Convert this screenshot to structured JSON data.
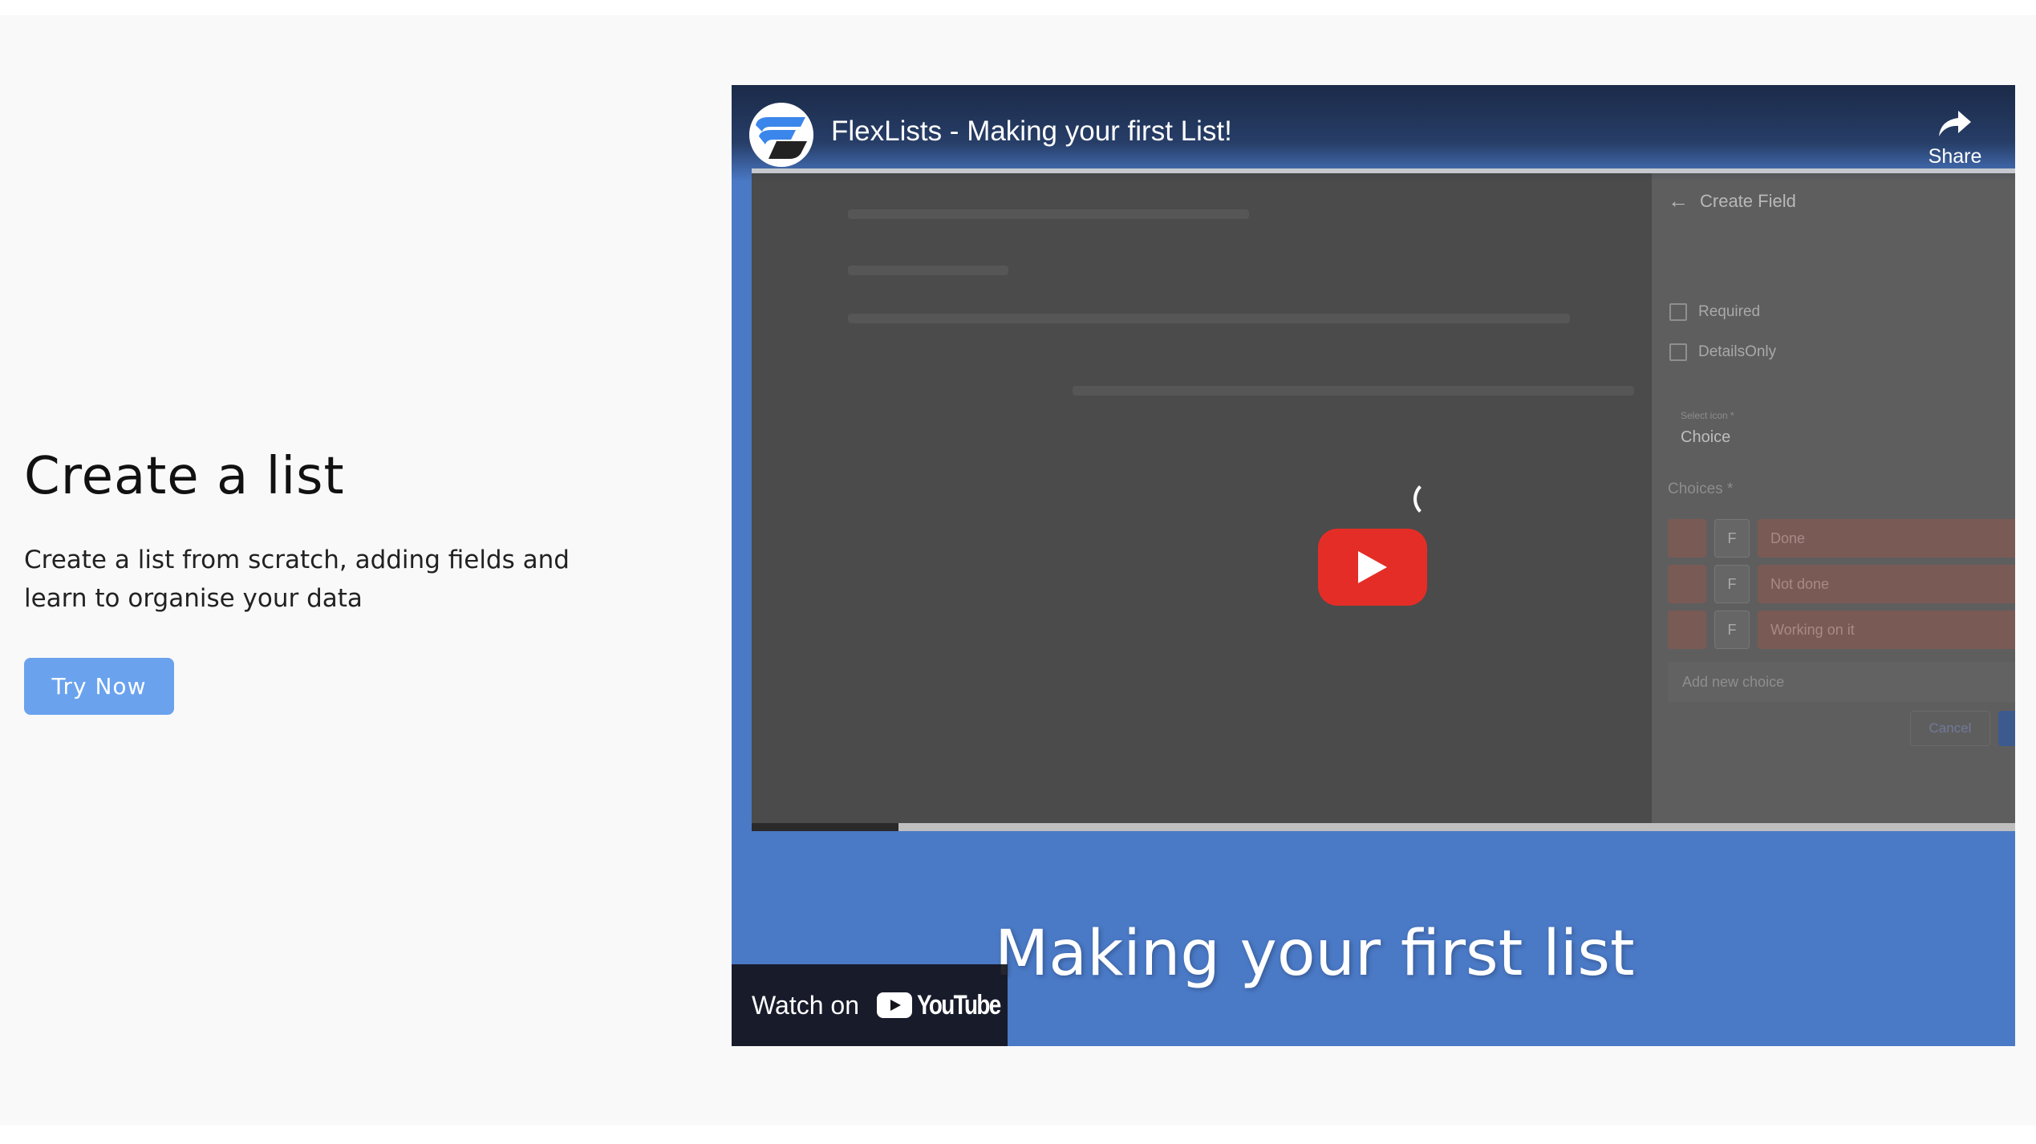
{
  "section": {
    "heading": "Create a list",
    "description": "Create a list from scratch, adding fields and learn to organise your data",
    "cta_label": "Try Now"
  },
  "video": {
    "title": "FlexLists - Making your first List!",
    "share_label": "Share",
    "watch_on_label": "Watch on",
    "youtube_label": "YouTube",
    "caption": "Making your first list",
    "progress": 0.116,
    "colors": {
      "background": "#4a79c6",
      "play_button": "#e52d27",
      "cta": "#6aa2ee"
    },
    "panel": {
      "title": "Create Field",
      "required_label": "Required",
      "details_only_label": "DetailsOnly",
      "select_icon_label": "Select icon *",
      "select_icon_value": "Choice",
      "choices_label": "Choices *",
      "choices": [
        {
          "marker": "F",
          "label": "Done"
        },
        {
          "marker": "F",
          "label": "Not done"
        },
        {
          "marker": "F",
          "label": "Working on it"
        }
      ],
      "add_choice_label": "Add new choice",
      "cancel_label": "Cancel"
    }
  }
}
